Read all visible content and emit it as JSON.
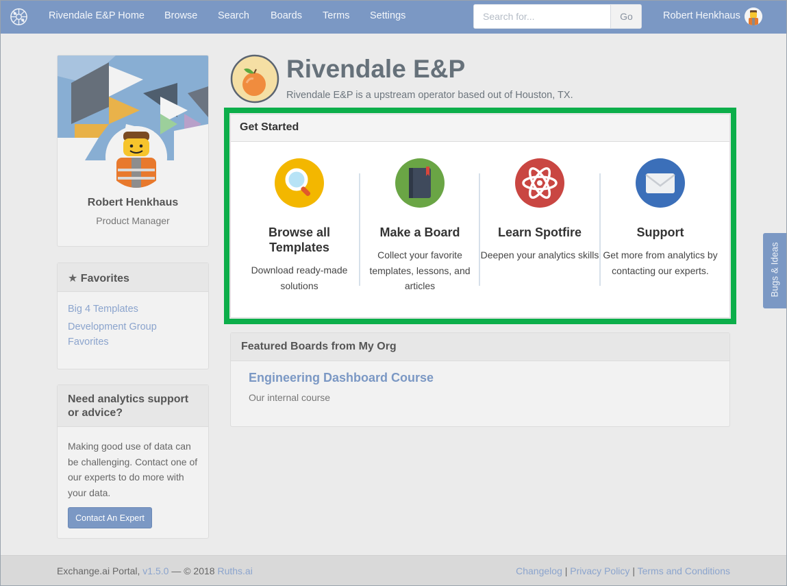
{
  "nav": {
    "items": [
      {
        "label": "Rivendale E&P Home"
      },
      {
        "label": "Browse"
      },
      {
        "label": "Search"
      },
      {
        "label": "Boards"
      },
      {
        "label": "Terms"
      },
      {
        "label": "Settings"
      }
    ],
    "search_placeholder": "Search for...",
    "search_button": "Go",
    "user_name": "Robert Henkhaus"
  },
  "profile": {
    "name": "Robert Henkhaus",
    "role": "Product Manager"
  },
  "favorites": {
    "title": "Favorites",
    "items": [
      "Big 4 Templates",
      "Development Group",
      "Favorites"
    ]
  },
  "support": {
    "title": "Need analytics support or advice?",
    "text": "Making good use of data can be challenging. Contact one of our experts to do more with your data.",
    "button": "Contact An Expert"
  },
  "org": {
    "title": "Rivendale E&P",
    "description": "Rivendale E&P is a upstream operator based out of Houston, TX."
  },
  "get_started": {
    "title": "Get Started",
    "items": [
      {
        "title": "Browse all Templates",
        "desc": "Download ready-made solutions",
        "icon": "magnifier-icon",
        "color": "#f3b700"
      },
      {
        "title": "Make a Board",
        "desc": "Collect your favorite templates, lessons, and articles",
        "icon": "notebook-icon",
        "color": "#6aa545"
      },
      {
        "title": "Learn Spotfire",
        "desc": "Deepen your analytics skills",
        "icon": "atom-icon",
        "color": "#c94642"
      },
      {
        "title": "Support",
        "desc": "Get more from analytics by contacting our experts.",
        "icon": "envelope-icon",
        "color": "#3b6fb9"
      }
    ]
  },
  "featured": {
    "title": "Featured Boards from My Org",
    "board_title": "Engineering Dashboard Course",
    "board_desc": "Our internal course"
  },
  "side_tab": "Bugs & Ideas",
  "footer": {
    "portal": "Exchange.ai Portal,",
    "version": "v1.5.0",
    "copyright": "— © 2018",
    "company": "Ruths.ai",
    "links": [
      "Changelog",
      "Privacy Policy",
      "Terms and Conditions"
    ],
    "separator": "|"
  },
  "colors": {
    "nav": "#7b98c4",
    "highlight": "#0cae4a",
    "link": "#8ba4cd"
  }
}
